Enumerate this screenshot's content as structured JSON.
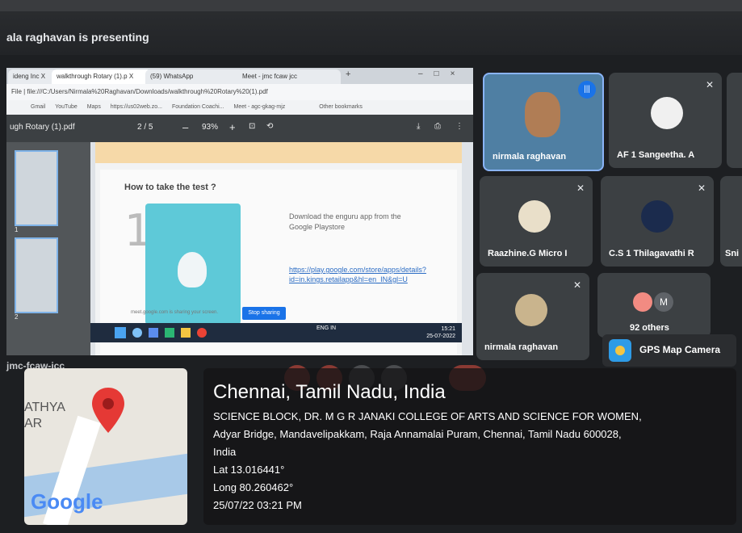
{
  "meet": {
    "presenting_banner": "ala raghavan is presenting"
  },
  "browser": {
    "tabs": [
      "ideng Inc X",
      "walkthrough Rotary (1).p X",
      "(59) WhatsApp",
      "Meet - jmc fcaw jcc"
    ],
    "address": "File | file:///C:/Users/Nirmala%20Raghavan/Downloads/walkthrough%20Rotary%20(1).pdf",
    "bookmarks": [
      "Gmail",
      "YouTube",
      "Maps",
      "https://us02web.zo...",
      "Foundation Coachi...",
      "Meet - agc-gkag-mjz",
      "Other bookmarks"
    ]
  },
  "pdf": {
    "filename": "ugh Rotary (1).pdf",
    "page_indicator": "2 / 5",
    "zoom": "93%",
    "heading": "How to take the test ?",
    "step_number": "1",
    "download_text": "Download the enguru app from the Google Playstore",
    "link_text": "https://play.google.com/store/apps/details?id=in.kings.retailapp&hl=en_IN&gl=U",
    "sharing_note": "meet.google.com is sharing your screen.",
    "stop_sharing": "Stop sharing",
    "thumb_labels": [
      "1",
      "2"
    ]
  },
  "taskbar": {
    "lang": "ENG IN",
    "time": "15:21",
    "date": "25-07-2022"
  },
  "participants": [
    {
      "name": "nirmala raghavan",
      "muted": false
    },
    {
      "name": "AF 1 Sangeetha. A",
      "muted": true
    },
    {
      "name": "Raazhine.G Micro I",
      "muted": true
    },
    {
      "name": "C.S 1 Thilagavathi R",
      "muted": true
    },
    {
      "name": "nirmala raghavan",
      "muted": true
    },
    {
      "name": "92 others",
      "muted": false
    },
    {
      "name": "M",
      "muted": false
    },
    {
      "name": "Sni",
      "muted": false
    }
  ],
  "meeting_code_partial": "jmc-fcaw-jcc",
  "gps": {
    "badge": "GPS Map Camera",
    "city": "Chennai, Tamil Nadu, India",
    "address_line1": "SCIENCE BLOCK, DR. M G R JANAKI COLLEGE OF ARTS AND SCIENCE FOR WOMEN,",
    "address_line2": "Adyar Bridge, Mandavelipakkam, Raja Annamalai Puram, Chennai, Tamil Nadu 600028,",
    "address_line3": "India",
    "lat": "Lat 13.016441°",
    "long": "Long 80.260462°",
    "datetime": "25/07/22 03:21 PM",
    "map_labels": [
      "ATHYA",
      "AR"
    ],
    "map_logo": "Google"
  },
  "colors": {
    "accent": "#1a73e8",
    "pin": "#e53935",
    "tile": "#3c4043"
  }
}
